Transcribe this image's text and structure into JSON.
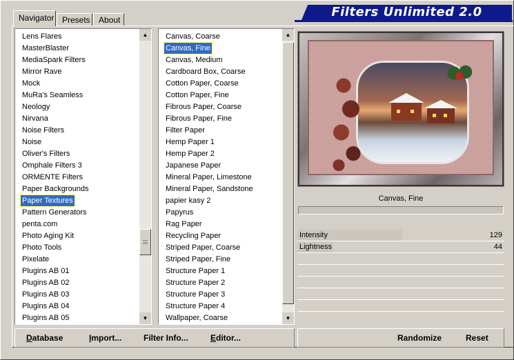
{
  "banner": {
    "title": "Filters Unlimited 2.0"
  },
  "tabs": [
    {
      "label": "Navigator",
      "active": true
    },
    {
      "label": "Presets",
      "active": false
    },
    {
      "label": "About",
      "active": false
    }
  ],
  "categories": {
    "items": [
      "Lens Flares",
      "MasterBlaster",
      "MediaSpark Filters",
      "Mirror Rave",
      "Mock",
      "MuRa's Seamless",
      "Neology",
      "Nirvana",
      "Noise Filters",
      "Noise",
      "Oliver's Filters",
      "Omphale Filters 3",
      "ORMENTE Filters",
      "Paper Backgrounds",
      "Paper Textures",
      "Pattern Generators",
      "penta.com",
      "Photo Aging Kit",
      "Photo Tools",
      "Pixelate",
      "Plugins AB 01",
      "Plugins AB 02",
      "Plugins AB 03",
      "Plugins AB 04",
      "Plugins AB 05"
    ],
    "selected_index": 14
  },
  "filters": {
    "items": [
      "Canvas, Coarse",
      "Canvas, Fine",
      "Canvas, Medium",
      "Cardboard Box, Coarse",
      "Cotton Paper, Coarse",
      "Cotton Paper, Fine",
      "Fibrous Paper, Coarse",
      "Fibrous Paper, Fine",
      "Filter Paper",
      "Hemp Paper 1",
      "Hemp Paper 2",
      "Japanese Paper",
      "Mineral Paper, Limestone",
      "Mineral Paper, Sandstone",
      "papier kasy 2",
      "Papyrus",
      "Rag Paper",
      "Recycling Paper",
      "Striped Paper, Coarse",
      "Striped Paper, Fine",
      "Structure Paper 1",
      "Structure Paper 2",
      "Structure Paper 3",
      "Structure Paper 4",
      "Wallpaper, Coarse"
    ],
    "selected_index": 1
  },
  "preview": {
    "filter_name": "Canvas, Fine"
  },
  "controls": [
    {
      "label": "Intensity",
      "value": "129",
      "level": 0.506
    },
    {
      "label": "Lightness",
      "value": "44",
      "level": 0.173
    }
  ],
  "buttons_left": [
    {
      "label": "Database",
      "underline": "D",
      "rest": "atabase"
    },
    {
      "label": "Import...",
      "underline": "I",
      "rest": "mport..."
    },
    {
      "label": "Filter Info...",
      "underline": "",
      "rest": "Filter Info..."
    },
    {
      "label": "Editor...",
      "underline": "E",
      "rest": "ditor..."
    }
  ],
  "buttons_right": [
    {
      "label": "Randomize"
    },
    {
      "label": "Reset"
    }
  ],
  "colors": {
    "banner": "#0c1a8c",
    "selection": "#316ac5",
    "chrome": "#d4d0c8"
  },
  "icons": {
    "scroll_up": "▲",
    "scroll_down": "▼"
  }
}
